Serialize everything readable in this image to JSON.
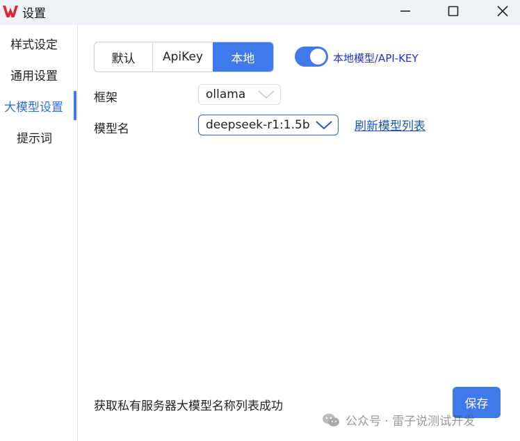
{
  "window": {
    "title": "设置",
    "logo_icon": "wps-logo-icon",
    "controls": [
      "minimize-icon",
      "maximize-icon",
      "close-icon"
    ]
  },
  "sidebar": {
    "items": [
      {
        "label": "样式设定",
        "active": false
      },
      {
        "label": "通用设置",
        "active": false
      },
      {
        "label": "大模型设置",
        "active": true
      },
      {
        "label": "提示词",
        "active": false
      }
    ]
  },
  "main": {
    "mode_tabs": [
      {
        "label": "默认",
        "selected": false
      },
      {
        "label": "ApiKey",
        "selected": false
      },
      {
        "label": "本地",
        "selected": true
      }
    ],
    "toggle": {
      "label": "本地模型/API-KEY",
      "on": true
    },
    "framework": {
      "label": "框架",
      "value": "ollama"
    },
    "model": {
      "label": "模型名",
      "value": "deepseek-r1:1.5b",
      "refresh_link": "刷新模型列表"
    },
    "status_text": "获取私有服务器大模型名称列表成功",
    "save_label": "保存"
  },
  "watermark": {
    "text": "公众号 · 雷子说测试开发",
    "icon": "wechat-icon"
  },
  "colors": {
    "accent": "#3f79ea",
    "link": "#1b55b8",
    "toggle_label": "#2033c8",
    "titlebar_bg": "#eef1f6",
    "logo_red": "#e3262b"
  }
}
